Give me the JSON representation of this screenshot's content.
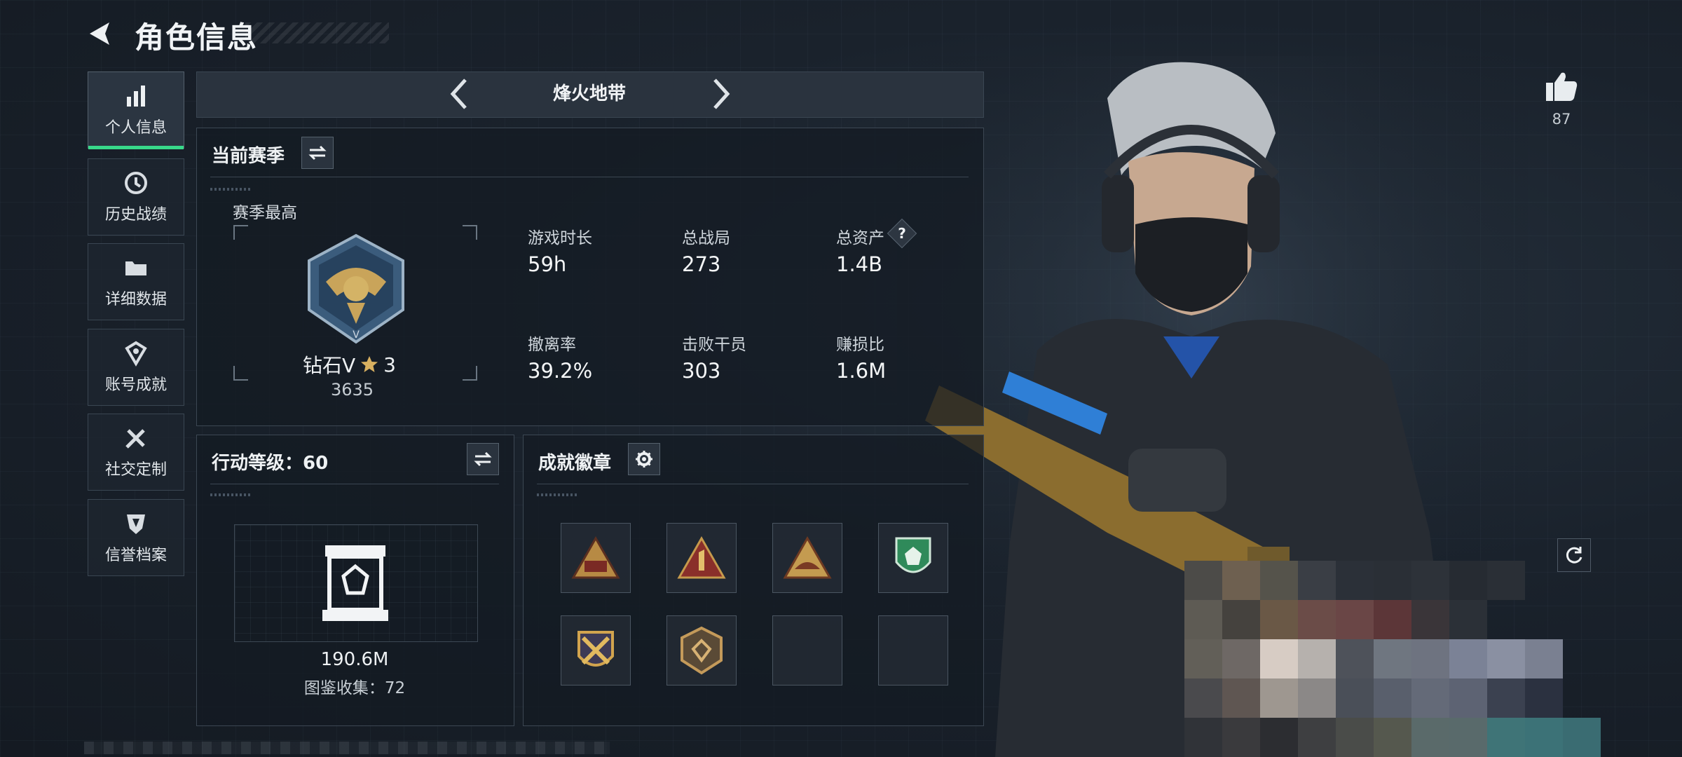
{
  "header": {
    "title": "角色信息"
  },
  "sidebar": {
    "items": [
      {
        "label": "个人信息",
        "icon": "bar-chart-icon",
        "active": true
      },
      {
        "label": "历史战绩",
        "icon": "history-icon"
      },
      {
        "label": "详细数据",
        "icon": "folder-icon"
      },
      {
        "label": "账号成就",
        "icon": "achievement-icon"
      },
      {
        "label": "社交定制",
        "icon": "tools-icon"
      },
      {
        "label": "信誉档案",
        "icon": "credit-shield-icon"
      }
    ]
  },
  "mode": {
    "title": "烽火地带"
  },
  "season": {
    "title": "当前赛季",
    "best_label": "赛季最高",
    "rank_name": "钻石V",
    "rank_stars": "3",
    "rank_score": "3635",
    "stats": [
      {
        "label": "游戏时长",
        "value": "59h"
      },
      {
        "label": "总战局",
        "value": "273"
      },
      {
        "label": "总资产",
        "value": "1.4B",
        "help": "?"
      },
      {
        "label": "撤离率",
        "value": "39.2%"
      },
      {
        "label": "击败干员",
        "value": "303"
      },
      {
        "label": "赚损比",
        "value": "1.6M"
      }
    ]
  },
  "action_level": {
    "title": "行动等级：60",
    "value": "190.6M",
    "collection": "图鉴收集：72"
  },
  "achievements": {
    "title": "成就徽章"
  },
  "likes": {
    "count": "87"
  },
  "colors": {
    "accent": "#38d98a",
    "panel_border": "#3c4753",
    "gold": "#c9a45a"
  }
}
